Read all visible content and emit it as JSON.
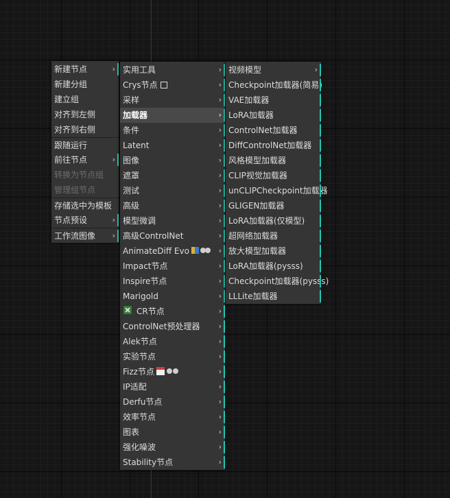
{
  "menu_main": {
    "items": [
      {
        "label": "新建节点",
        "submenu": true,
        "bar": true,
        "arrow": "›"
      },
      {
        "label": "新建分组"
      },
      {
        "label": "建立组"
      },
      {
        "label": "对齐到左侧"
      },
      {
        "label": "对齐到右侧"
      },
      {
        "label": "跟随运行",
        "separator": true
      },
      {
        "label": "前往节点",
        "submenu": true,
        "bar": true,
        "arrow": "›"
      },
      {
        "label": "转换为节点组",
        "disabled": true
      },
      {
        "label": "管理组节点",
        "disabled": true
      },
      {
        "label": "存储选中为模板",
        "separator": true
      },
      {
        "label": "节点预设",
        "submenu": true,
        "bar": true,
        "arrow": "›"
      },
      {
        "label": "工作流图像",
        "submenu": true,
        "bar": true,
        "separator": true,
        "arrow": "›"
      }
    ]
  },
  "menu_nodes": {
    "items": [
      {
        "label": "实用工具",
        "submenu": true,
        "bar": true,
        "arrow": "›"
      },
      {
        "label": "Crys节点",
        "submenu": true,
        "bar": true,
        "arrow": "›",
        "icon": "square-icon"
      },
      {
        "label": "采样",
        "submenu": true,
        "bar": true,
        "arrow": "›"
      },
      {
        "label": "加载器",
        "submenu": true,
        "bar": true,
        "arrow": "›",
        "highlight": true
      },
      {
        "label": "条件",
        "submenu": true,
        "bar": true,
        "arrow": "›"
      },
      {
        "label": "Latent",
        "submenu": true,
        "bar": true,
        "arrow": "›"
      },
      {
        "label": "图像",
        "submenu": true,
        "bar": true,
        "arrow": "›"
      },
      {
        "label": "遮罩",
        "submenu": true,
        "bar": true,
        "arrow": "›"
      },
      {
        "label": "测试",
        "submenu": true,
        "bar": true,
        "arrow": "›"
      },
      {
        "label": "高级",
        "submenu": true,
        "bar": true,
        "arrow": "›"
      },
      {
        "label": "模型微调",
        "submenu": true,
        "bar": true,
        "arrow": "›"
      },
      {
        "label": "高级ControlNet",
        "submenu": true,
        "bar": true,
        "arrow": "›"
      },
      {
        "label": "AnimateDiff Evo",
        "submenu": true,
        "bar": true,
        "arrow": "›",
        "icon": "mask-badge-icon"
      },
      {
        "label": "Impact节点",
        "submenu": true,
        "bar": true,
        "arrow": "›"
      },
      {
        "label": "Inspire节点",
        "submenu": true,
        "bar": true,
        "arrow": "›"
      },
      {
        "label": "Marigold",
        "submenu": true,
        "bar": true,
        "arrow": "›"
      },
      {
        "label": "CR节点",
        "submenu": true,
        "bar": true,
        "arrow": "›",
        "icon": "puzzle-icon",
        "icon_before": true
      },
      {
        "label": "ControlNet预处理器",
        "submenu": true,
        "bar": true,
        "arrow": "›"
      },
      {
        "label": "Alek节点",
        "submenu": true,
        "bar": true,
        "arrow": "›"
      },
      {
        "label": "实验节点",
        "submenu": true,
        "bar": true,
        "arrow": "›"
      },
      {
        "label": "Fizz节点",
        "submenu": true,
        "bar": true,
        "arrow": "›",
        "icon": "calendar-badge-icon"
      },
      {
        "label": "IP适配",
        "submenu": true,
        "bar": true,
        "arrow": "›"
      },
      {
        "label": "Derfu节点",
        "submenu": true,
        "bar": true,
        "arrow": "›"
      },
      {
        "label": "效率节点",
        "submenu": true,
        "bar": true,
        "arrow": "›"
      },
      {
        "label": "图表",
        "submenu": true,
        "bar": true,
        "arrow": "›"
      },
      {
        "label": "强化噪波",
        "submenu": true,
        "bar": true,
        "arrow": "›"
      },
      {
        "label": "Stability节点",
        "submenu": true,
        "bar": true,
        "arrow": "›"
      }
    ]
  },
  "menu_loaders": {
    "items": [
      {
        "label": "视频模型",
        "submenu": true,
        "bar": true,
        "arrow": "›"
      },
      {
        "label": "Checkpoint加载器(简易)",
        "bar": true
      },
      {
        "label": "VAE加载器",
        "bar": true
      },
      {
        "label": "LoRA加载器",
        "bar": true
      },
      {
        "label": "ControlNet加载器",
        "bar": true
      },
      {
        "label": "DiffControlNet加载器",
        "bar": true
      },
      {
        "label": "风格模型加载器",
        "bar": true
      },
      {
        "label": "CLIP视觉加载器",
        "bar": true
      },
      {
        "label": "unCLIPCheckpoint加载器",
        "bar": true
      },
      {
        "label": "GLIGEN加载器",
        "bar": true
      },
      {
        "label": "LoRA加载器(仅模型)",
        "bar": true
      },
      {
        "label": "超网络加载器",
        "bar": true
      },
      {
        "label": "放大模型加载器",
        "bar": true
      },
      {
        "label": "LoRA加载器(pysss)",
        "bar": true
      },
      {
        "label": "Checkpoint加载器(pysss)",
        "bar": true
      },
      {
        "label": "LLLite加载器",
        "bar": true
      }
    ]
  },
  "colors": {
    "accent_bar": "#22c6b2",
    "menu_bg": "#353535",
    "highlight_bg": "#494949"
  }
}
